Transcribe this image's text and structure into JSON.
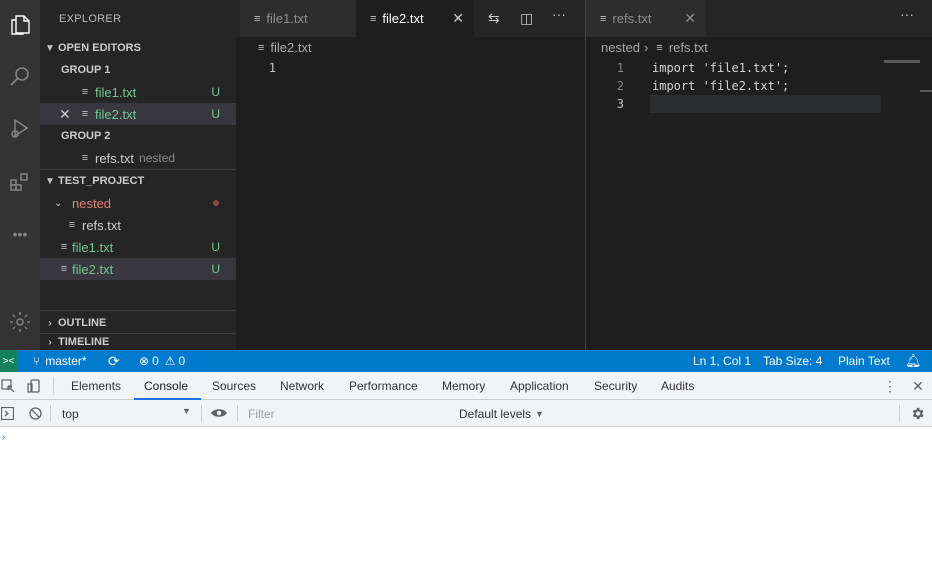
{
  "sidebar": {
    "title": "EXPLORER",
    "open_editors_header": "OPEN EDITORS",
    "group1_label": "GROUP 1",
    "group1_files": [
      {
        "name": "file1.txt",
        "badge": "U"
      },
      {
        "name": "file2.txt",
        "badge": "U"
      }
    ],
    "group2_label": "GROUP 2",
    "group2_files": [
      {
        "name": "refs.txt",
        "description": "nested"
      }
    ],
    "project_header": "TEST_PROJECT",
    "tree": [
      {
        "name": "nested"
      },
      {
        "name": "refs.txt"
      },
      {
        "name": "file1.txt",
        "badge": "U"
      },
      {
        "name": "file2.txt",
        "badge": "U"
      }
    ],
    "outline_header": "OUTLINE",
    "timeline_header": "TIMELINE"
  },
  "editor_left": {
    "tabs": [
      {
        "label": "file1.txt"
      },
      {
        "label": "file2.txt"
      }
    ],
    "breadcrumb": "file2.txt",
    "lines": [
      {
        "number": "1",
        "text": ""
      }
    ]
  },
  "editor_right": {
    "tabs": [
      {
        "label": "refs.txt"
      }
    ],
    "breadcrumb_folder": "nested",
    "breadcrumb_file": "refs.txt",
    "lines": [
      {
        "number": "1",
        "text": "import 'file1.txt';"
      },
      {
        "number": "2",
        "text": "import 'file2.txt';"
      },
      {
        "number": "3",
        "text": ""
      }
    ]
  },
  "statusbar": {
    "branch": "master*",
    "errors": "0",
    "warnings": "0",
    "position": "Ln 1, Col 1",
    "tab_size": "Tab Size: 4",
    "language": "Plain Text"
  },
  "devtools": {
    "tabs": [
      "Elements",
      "Console",
      "Sources",
      "Network",
      "Performance",
      "Memory",
      "Application",
      "Security",
      "Audits"
    ],
    "active_tab": "Console",
    "context": "top",
    "filter_placeholder": "Filter",
    "levels": "Default levels"
  },
  "colors": {
    "statusbar": "#007acc",
    "untracked": "#73c991",
    "modified_folder": "#e2806f",
    "devtools_accent": "#1a73e8"
  },
  "icons": [
    "files-icon",
    "search-icon",
    "run-debug-icon",
    "extensions-icon",
    "more-icon",
    "gear-icon"
  ]
}
